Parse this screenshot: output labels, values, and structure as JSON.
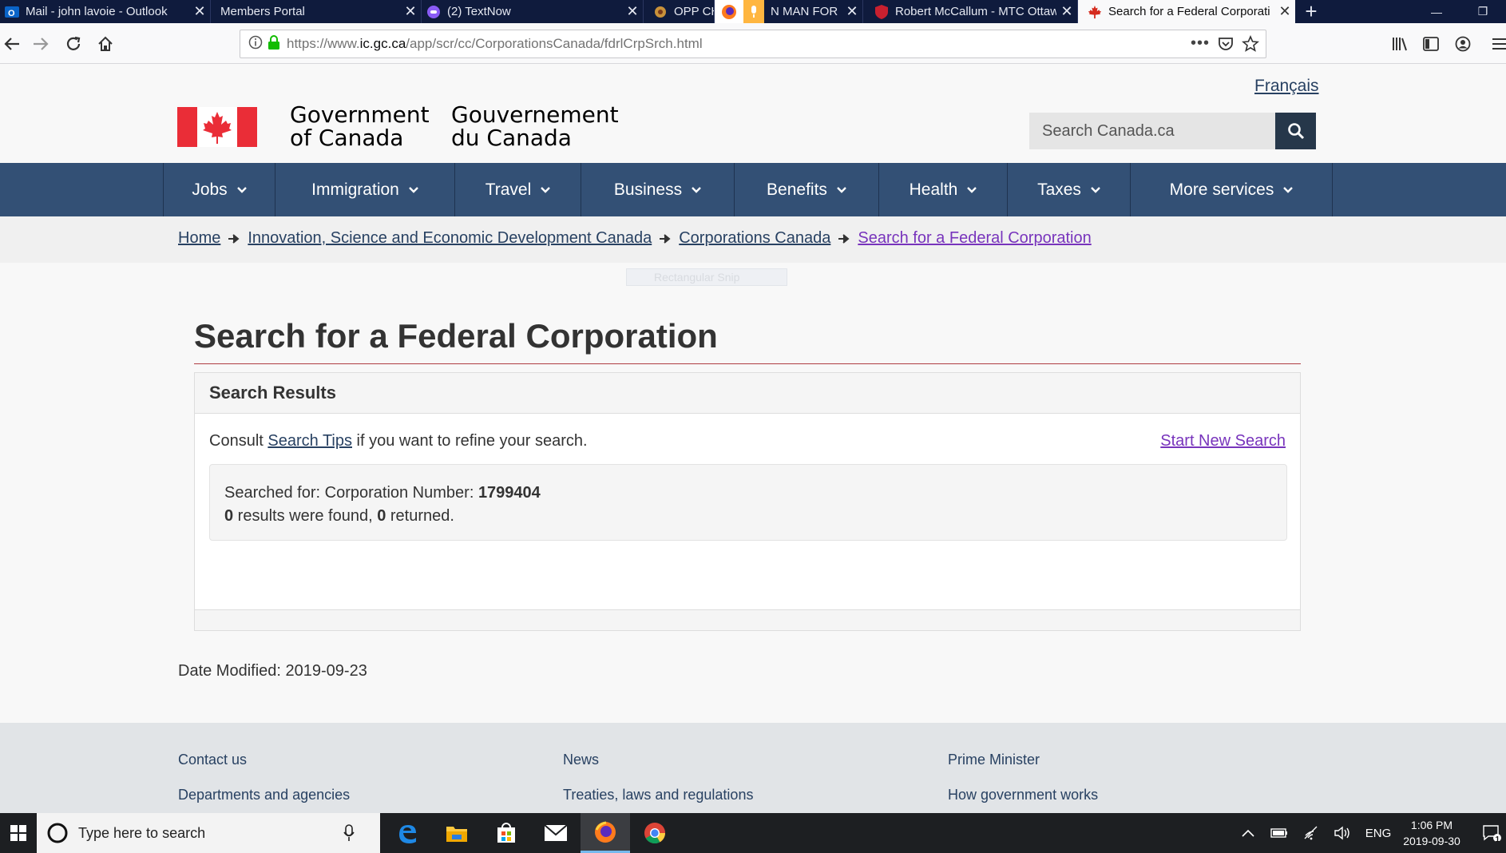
{
  "browser": {
    "tabs": [
      {
        "title": "Mail - john lavoie - Outlook",
        "icon": "outlook-icon",
        "active": false
      },
      {
        "title": "Members Portal",
        "icon": "",
        "active": false
      },
      {
        "title": "(2) TextNow",
        "icon": "textnow-icon",
        "active": false
      },
      {
        "title": "OPP CHA",
        "icon": "opp-icon",
        "active": false
      },
      {
        "title": "N MAN FOR",
        "icon": "firefox-icon",
        "active": false
      },
      {
        "title": "Robert McCallum - MTC Ottaw",
        "icon": "shield-icon",
        "active": false
      },
      {
        "title": "Search for a Federal Corporati",
        "icon": "maple-leaf-icon",
        "active": true
      }
    ],
    "url_prefix": "https://www.",
    "url_domain": "ic.gc.ca",
    "url_path": "/app/scr/cc/CorporationsCanada/fdrlCrpSrch.html"
  },
  "header": {
    "language_link": "Français",
    "wordmark_en_line1": "Government",
    "wordmark_en_line2": "of Canada",
    "wordmark_fr_line1": "Gouvernement",
    "wordmark_fr_line2": "du Canada",
    "search_placeholder": "Search Canada.ca"
  },
  "menu": [
    {
      "label": "Jobs"
    },
    {
      "label": "Immigration"
    },
    {
      "label": "Travel"
    },
    {
      "label": "Business"
    },
    {
      "label": "Benefits"
    },
    {
      "label": "Health"
    },
    {
      "label": "Taxes"
    },
    {
      "label": "More services"
    }
  ],
  "breadcrumb": [
    {
      "label": "Home"
    },
    {
      "label": "Innovation, Science and Economic Development Canada"
    },
    {
      "label": "Corporations Canada"
    },
    {
      "label": "Search for a Federal Corporation"
    }
  ],
  "overlay": {
    "snip_label": "Rectangular Snip"
  },
  "main": {
    "title": "Search for a Federal Corporation",
    "panel_heading": "Search Results",
    "consult_prefix": "Consult ",
    "consult_link": "Search Tips",
    "consult_suffix": " if you want to refine your search.",
    "start_new_search": "Start New Search",
    "searched_for_label": "Searched for: Corporation Number: ",
    "searched_for_value": "1799404",
    "results_found": "0",
    "results_found_text": " results were found, ",
    "results_returned": "0",
    "results_returned_text": " returned.",
    "date_modified": "Date Modified: 2019-09-23"
  },
  "footer": {
    "links": [
      {
        "label": "Contact us"
      },
      {
        "label": "News"
      },
      {
        "label": "Prime Minister"
      },
      {
        "label": "Departments and agencies"
      },
      {
        "label": "Treaties, laws and regulations"
      },
      {
        "label": "How government works"
      }
    ]
  },
  "taskbar": {
    "search_placeholder": "Type here to search",
    "language": "ENG",
    "time": "1:06 PM",
    "date": "2019-09-30",
    "notification_count": "1"
  },
  "colors": {
    "menu_bg": "#335075",
    "search_btn": "#26374a",
    "link": "#284162",
    "visited_link": "#7834bc",
    "title_rule": "#af3c43",
    "flag_red": "#ea2d37"
  }
}
